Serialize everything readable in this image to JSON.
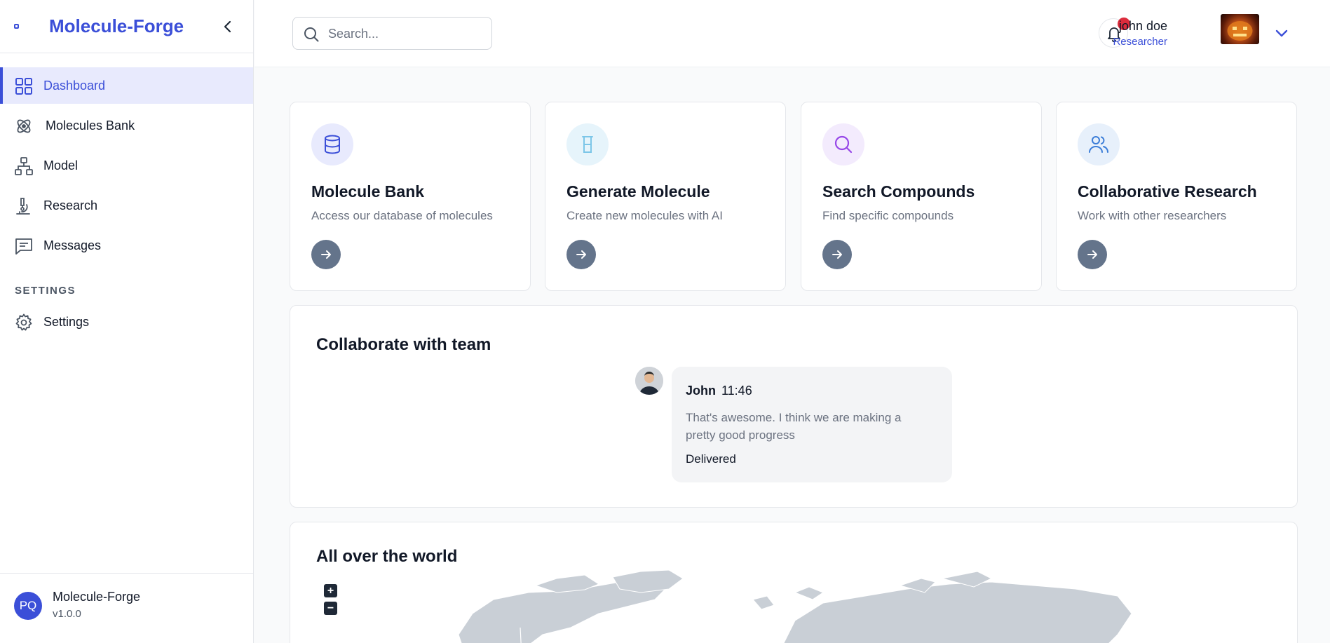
{
  "brand": {
    "title": "Molecule-Forge"
  },
  "sidebar": {
    "items": [
      {
        "label": "Dashboard"
      },
      {
        "label": "Molecules Bank"
      },
      {
        "label": "Model"
      },
      {
        "label": "Research"
      },
      {
        "label": "Messages"
      }
    ],
    "settings_section": "SETTINGS",
    "settings_item": "Settings",
    "footer": {
      "initials": "PQ",
      "name": "Molecule-Forge",
      "version": "v1.0.0"
    }
  },
  "header": {
    "search_placeholder": "Search...",
    "user_name": "john doe",
    "user_role": "Researcher"
  },
  "cards": [
    {
      "title": "Molecule Bank",
      "desc": "Access our database of molecules"
    },
    {
      "title": "Generate Molecule",
      "desc": "Create new molecules with AI"
    },
    {
      "title": "Search Compounds",
      "desc": "Find specific compounds"
    },
    {
      "title": "Collaborative Research",
      "desc": "Work with other researchers"
    }
  ],
  "collab": {
    "title": "Collaborate with team",
    "message": {
      "author": "John",
      "time": "11:46",
      "text": "That's awesome. I think we are making a pretty good progress",
      "status": "Delivered"
    }
  },
  "map": {
    "title": "All over the world",
    "zoom_in": "+",
    "zoom_out": "−"
  },
  "colors": {
    "accent": "#3b4fd8",
    "badge": "#dc2c3c",
    "arrow_button": "#64748b"
  }
}
